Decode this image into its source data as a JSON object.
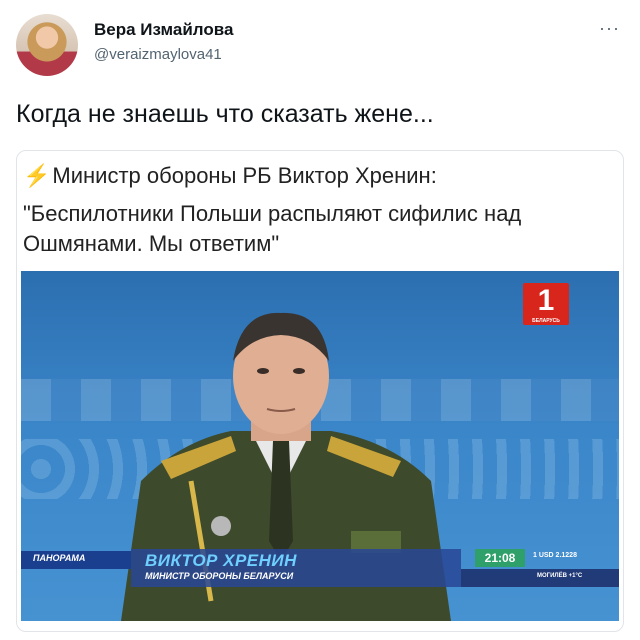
{
  "author": {
    "display_name": "Вера Измайлова",
    "handle": "@veraizmaylova41",
    "more_label": "···"
  },
  "tweet": {
    "text": "Когда не знаешь что сказать жене..."
  },
  "card": {
    "bolt": "⚡",
    "line1": "Министр обороны РБ Виктор Хренин:",
    "quote": "\"Беспилотники Польши распыляют сифилис над Ошмянами. Мы ответим\""
  },
  "tv": {
    "channel_number": "1",
    "channel_name": "БЕЛАРУСЬ",
    "program": "ПАНОРАМА",
    "person_name": "ВИКТОР ХРЕНИН",
    "person_title": "МИНИСТР ОБОРОНЫ БЕЛАРУСИ",
    "time": "21:08",
    "usd": "1 USD 2.1228",
    "city": "МОГИЛЁВ +1°С"
  },
  "colors": {
    "tv_logo": "#d9261c",
    "time_badge": "#2fa06a",
    "name_text": "#6fd0ff"
  }
}
